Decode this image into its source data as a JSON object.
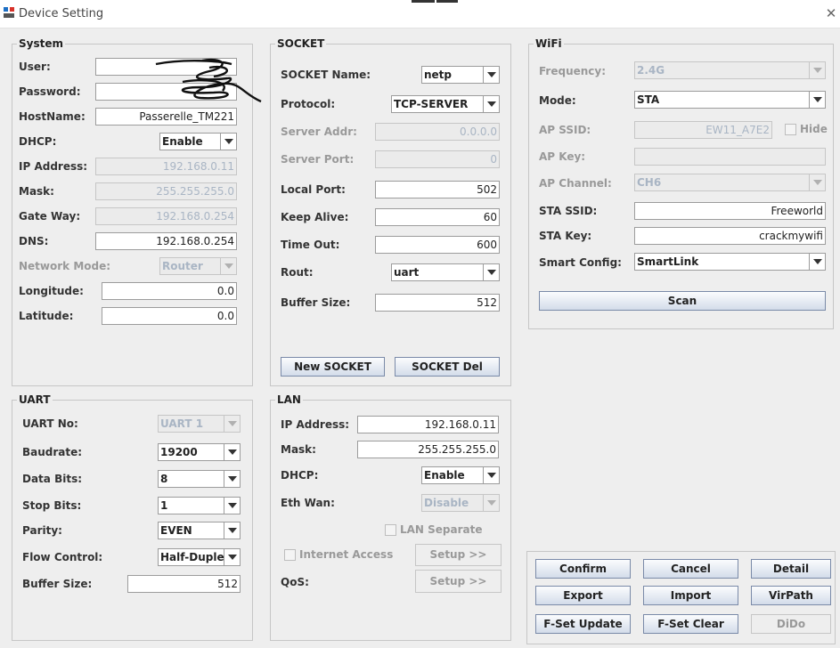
{
  "window": {
    "title": "Device Setting",
    "close": "✕"
  },
  "system": {
    "title": "System",
    "user": {
      "label": "User:",
      "value": ""
    },
    "password": {
      "label": "Password:",
      "value": ""
    },
    "hostname": {
      "label": "HostName:",
      "value": "Passerelle_TM221"
    },
    "dhcp": {
      "label": "DHCP:",
      "value": "Enable"
    },
    "ip": {
      "label": "IP Address:",
      "value": "192.168.0.11"
    },
    "mask": {
      "label": "Mask:",
      "value": "255.255.255.0"
    },
    "gateway": {
      "label": "Gate Way:",
      "value": "192.168.0.254"
    },
    "dns": {
      "label": "DNS:",
      "value": "192.168.0.254"
    },
    "network_mode": {
      "label": "Network Mode:",
      "value": "Router"
    },
    "longitude": {
      "label": "Longitude:",
      "value": "0.0"
    },
    "latitude": {
      "label": "Latitude:",
      "value": "0.0"
    }
  },
  "socket": {
    "title": "SOCKET",
    "name": {
      "label": "SOCKET Name:",
      "value": "netp"
    },
    "protocol": {
      "label": "Protocol:",
      "value": "TCP-SERVER"
    },
    "server_addr": {
      "label": "Server Addr:",
      "value": "0.0.0.0"
    },
    "server_port": {
      "label": "Server Port:",
      "value": "0"
    },
    "local_port": {
      "label": "Local Port:",
      "value": "502"
    },
    "keep_alive": {
      "label": "Keep Alive:",
      "value": "60"
    },
    "time_out": {
      "label": "Time Out:",
      "value": "600"
    },
    "rout": {
      "label": "Rout:",
      "value": "uart"
    },
    "buffer_size": {
      "label": "Buffer Size:",
      "value": "512"
    },
    "new_button": "New SOCKET",
    "del_button": "SOCKET Del"
  },
  "wifi": {
    "title": "WiFi",
    "frequency": {
      "label": "Frequency:",
      "value": "2.4G"
    },
    "mode": {
      "label": "Mode:",
      "value": "STA"
    },
    "ap_ssid": {
      "label": "AP SSID:",
      "value": "EW11_A7E2"
    },
    "hide": "Hide",
    "ap_key": {
      "label": "AP Key:",
      "value": ""
    },
    "ap_channel": {
      "label": "AP Channel:",
      "value": "CH6"
    },
    "sta_ssid": {
      "label": "STA SSID:",
      "value": "Freeworld"
    },
    "sta_key": {
      "label": "STA Key:",
      "value": "crackmywifi"
    },
    "smart_config": {
      "label": "Smart Config:",
      "value": "SmartLink"
    },
    "scan_button": "Scan"
  },
  "uart": {
    "title": "UART",
    "no": {
      "label": "UART No:",
      "value": "UART 1"
    },
    "baudrate": {
      "label": "Baudrate:",
      "value": "19200"
    },
    "data_bits": {
      "label": "Data Bits:",
      "value": "8"
    },
    "stop_bits": {
      "label": "Stop Bits:",
      "value": "1"
    },
    "parity": {
      "label": "Parity:",
      "value": "EVEN"
    },
    "flow_control": {
      "label": "Flow Control:",
      "value": "Half-Duplex"
    },
    "buffer_size": {
      "label": "Buffer Size:",
      "value": "512"
    }
  },
  "lan": {
    "title": "LAN",
    "ip": {
      "label": "IP Address:",
      "value": "192.168.0.11"
    },
    "mask": {
      "label": "Mask:",
      "value": "255.255.255.0"
    },
    "dhcp": {
      "label": "DHCP:",
      "value": "Enable"
    },
    "eth_wan": {
      "label": "Eth Wan:",
      "value": "Disable"
    },
    "lan_separate": "LAN Separate",
    "internet_access": "Internet Access",
    "setup1": "Setup >>",
    "qos": {
      "label": "QoS:"
    },
    "setup2": "Setup >>"
  },
  "actions": {
    "confirm": "Confirm",
    "cancel": "Cancel",
    "detail": "Detail",
    "export": "Export",
    "import": "Import",
    "virpath": "VirPath",
    "fset_update": "F-Set Update",
    "fset_clear": "F-Set Clear",
    "dido": "DiDo"
  }
}
